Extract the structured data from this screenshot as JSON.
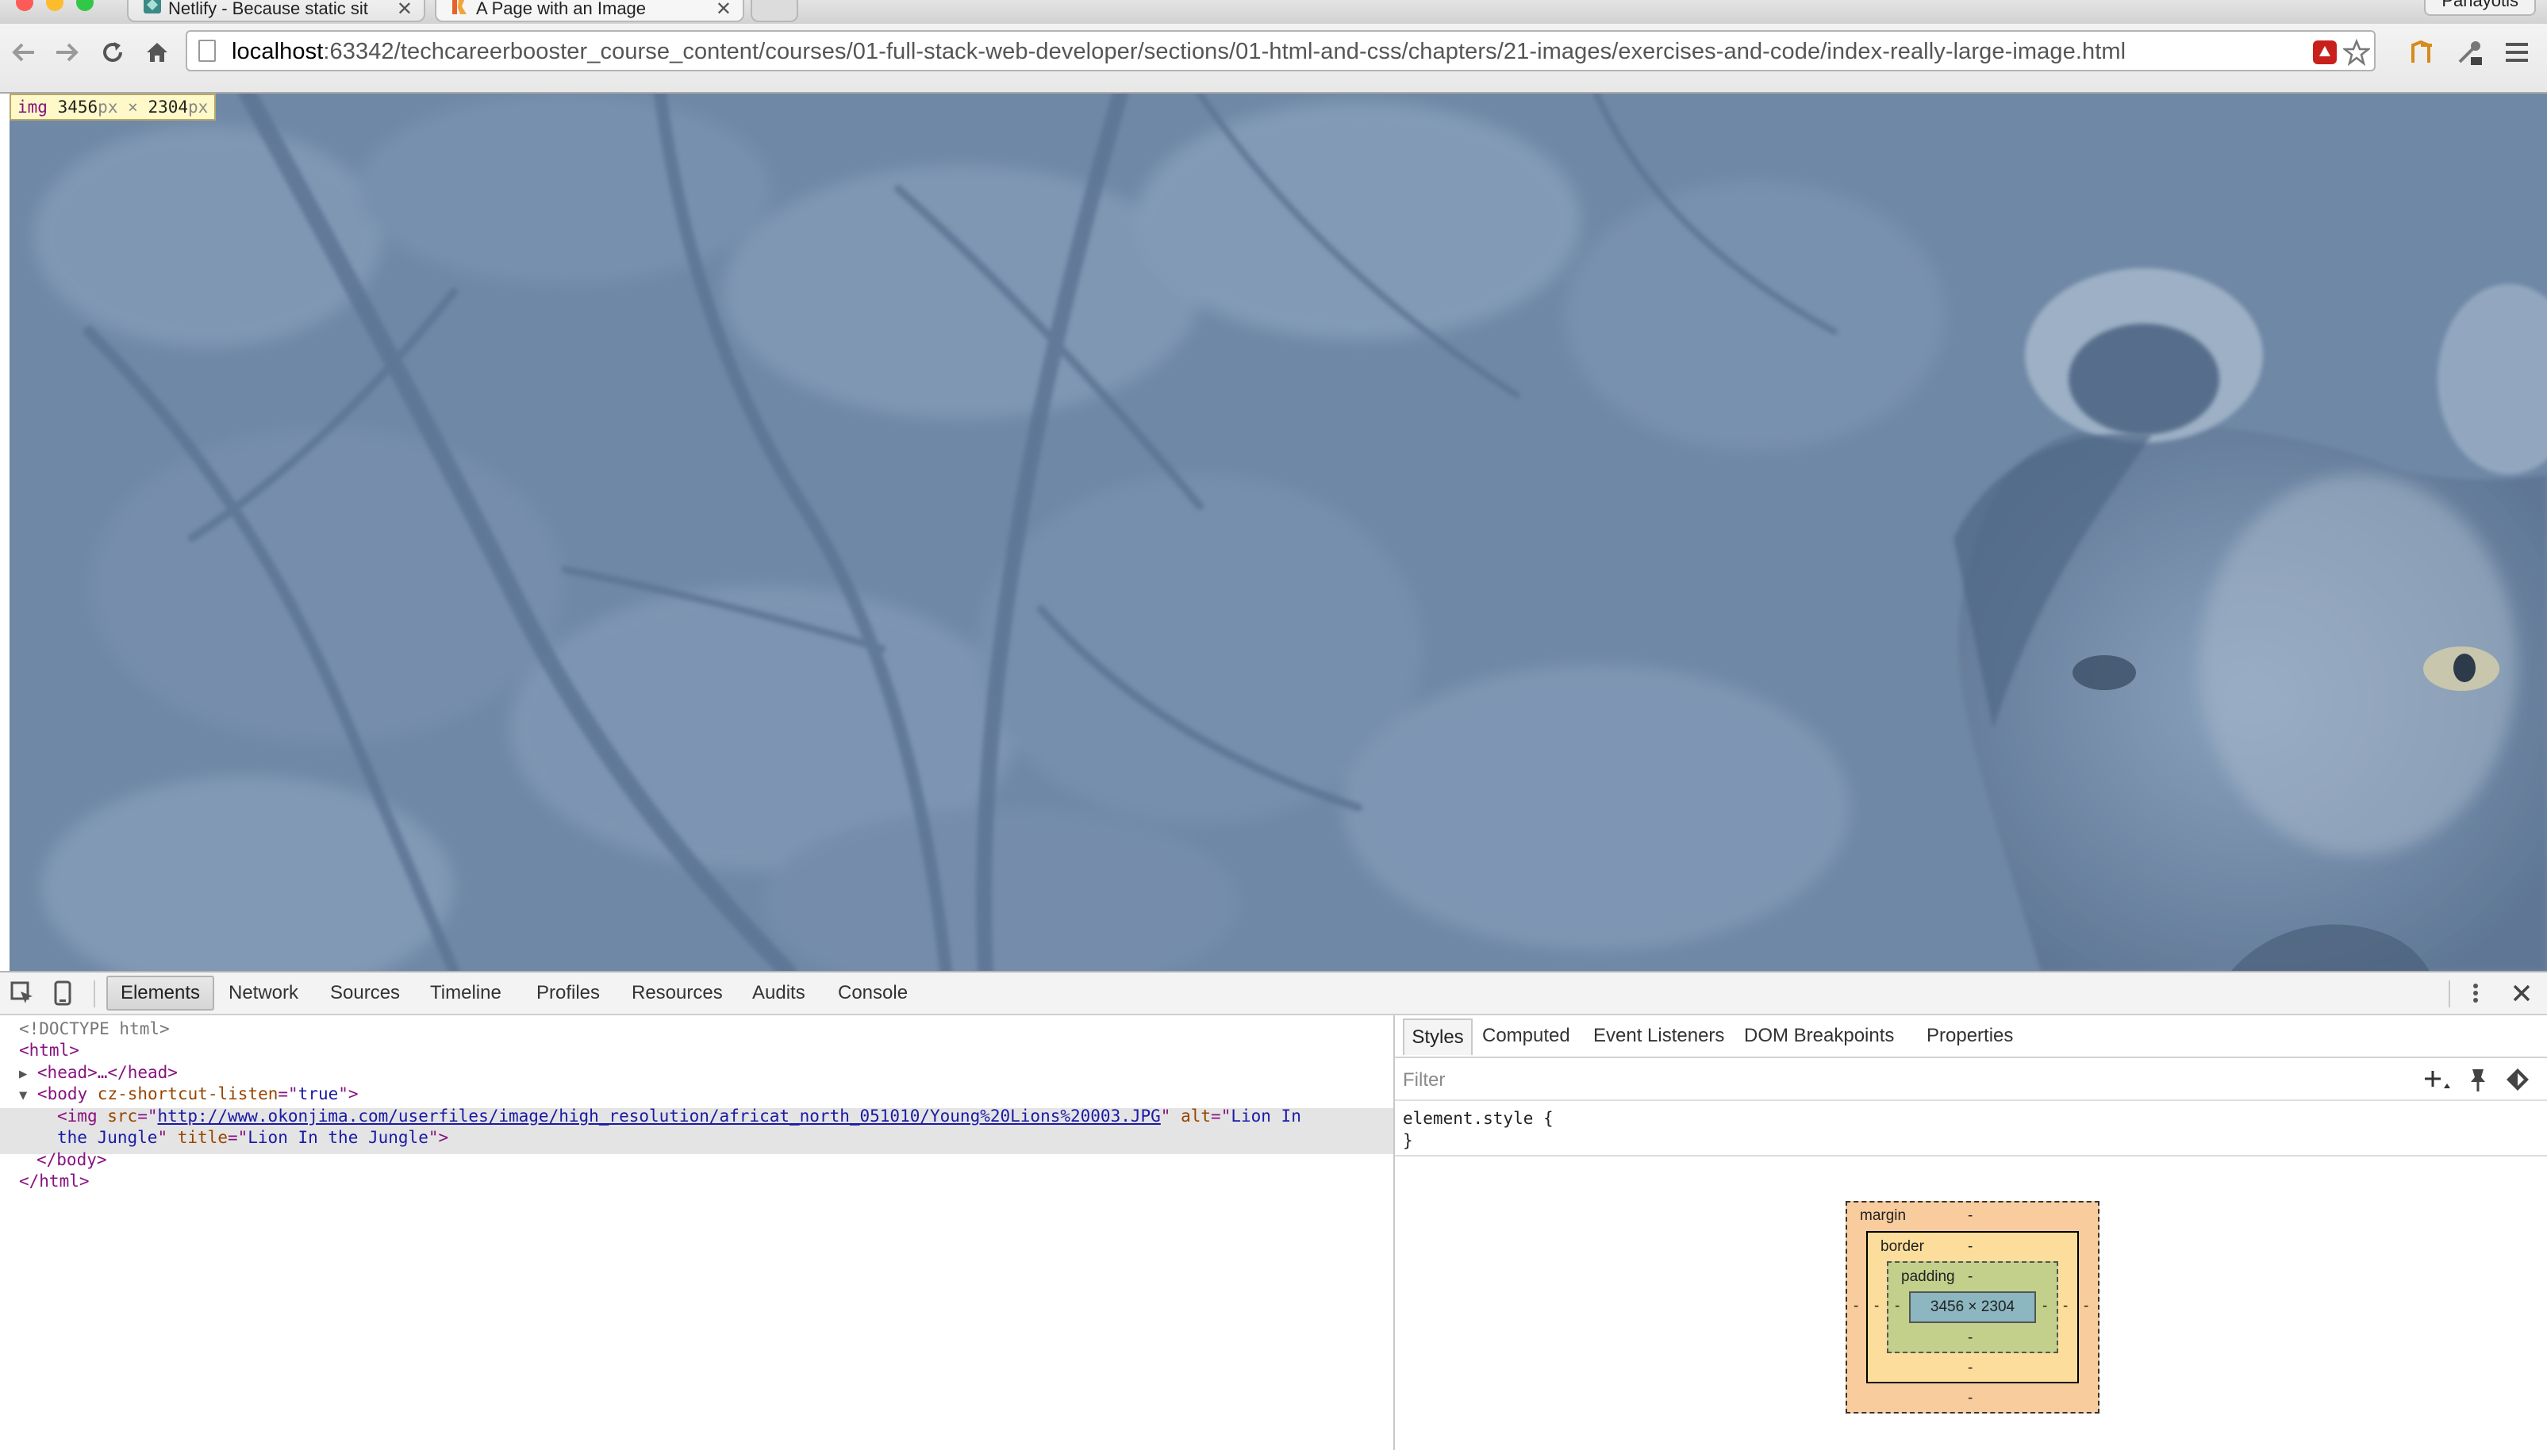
{
  "tabs": [
    {
      "title": "Netlify - Because static sit",
      "active": false
    },
    {
      "title": "A Page with an Image",
      "active": true
    }
  ],
  "profile_name": "Panayotis",
  "address_bar": {
    "host": "localhost",
    "path": ":63342/techcareerbooster_course_content/courses/01-full-stack-web-developer/sections/01-html-and-css/chapters/21-images/exercises-and-code/index-really-large-image.html"
  },
  "page": {
    "image_alt": "Lion In the Jungle",
    "inspect_badge": {
      "tag": "img",
      "width": "3456",
      "height": "2304",
      "unit": "px",
      "times": "×"
    }
  },
  "devtools": {
    "panels": [
      "Elements",
      "Network",
      "Sources",
      "Timeline",
      "Profiles",
      "Resources",
      "Audits",
      "Console"
    ],
    "active_panel": "Elements",
    "dom": {
      "doctype": "<!DOCTYPE html>",
      "html_open": "<html>",
      "head_collapsed": "<head>…</head>",
      "body_open_tag": "body",
      "body_attr_name": "cz-shortcut-listen",
      "body_attr_value": "true",
      "img_tag": "img",
      "img_src_attr": "src",
      "img_src": "http://www.okonjima.com/userfiles/image/high_resolution/africat_north_051010/Young%20Lions%20003.JPG",
      "img_alt_attr": "alt",
      "img_alt_part1": "Lion In",
      "img_alt_part2": "the Jungle",
      "img_title_attr": "title",
      "img_title": "Lion In the Jungle",
      "body_close": "</body>",
      "html_close": "</html>"
    },
    "sidebar_tabs": [
      "Styles",
      "Computed",
      "Event Listeners",
      "DOM Breakpoints",
      "Properties"
    ],
    "filter_placeholder": "Filter",
    "style_rule": {
      "selector": "element.style {",
      "close": "}"
    },
    "box_model": {
      "margin_label": "margin",
      "border_label": "border",
      "padding_label": "padding",
      "content": "3456 × 2304",
      "dash": "-"
    }
  },
  "colors": {
    "image_tint": "#6d86a4",
    "selection": "#e4e4e4"
  }
}
